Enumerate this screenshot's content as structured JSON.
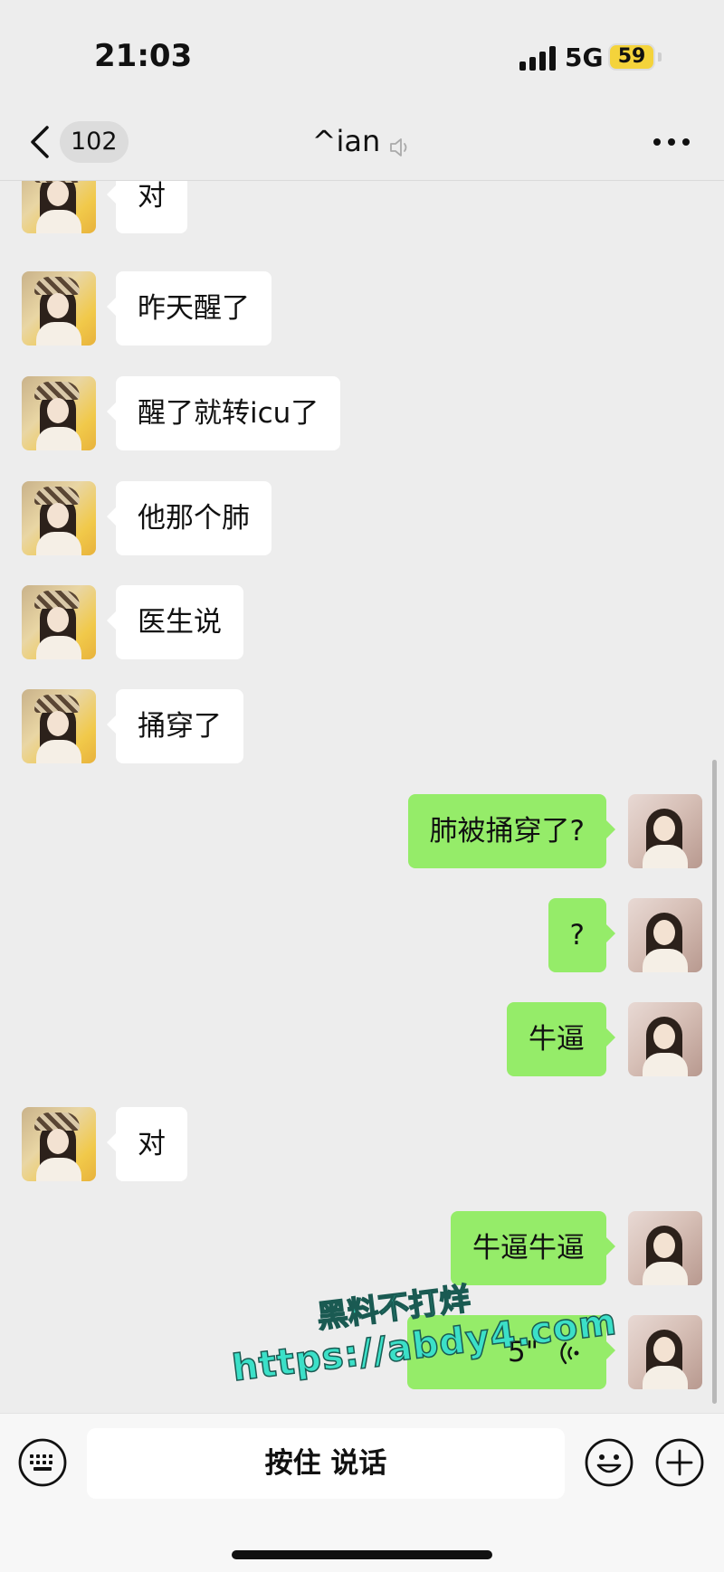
{
  "status_bar": {
    "time": "21:03",
    "network": "5G",
    "battery": "59"
  },
  "header": {
    "unread_count": "102",
    "title": "^ian"
  },
  "messages": [
    {
      "side": "in",
      "text": "对"
    },
    {
      "side": "in",
      "text": "昨天醒了"
    },
    {
      "side": "in",
      "text": "醒了就转icu了"
    },
    {
      "side": "in",
      "text": "他那个肺"
    },
    {
      "side": "in",
      "text": "医生说"
    },
    {
      "side": "in",
      "text": "捅穿了"
    },
    {
      "side": "out",
      "text": "肺被捅穿了?"
    },
    {
      "side": "out",
      "text": "?"
    },
    {
      "side": "out",
      "text": "牛逼"
    },
    {
      "side": "in",
      "text": "对"
    },
    {
      "side": "out",
      "text": "牛逼牛逼"
    },
    {
      "side": "out",
      "type": "voice",
      "duration": "5\""
    }
  ],
  "watermark": {
    "line1": "黑料不打烊",
    "line2": "https://abdy4.com"
  },
  "input_bar": {
    "hold_to_talk": "按住 说话"
  },
  "icons": {
    "back": "chevron-left-icon",
    "mute": "mute-icon",
    "more": "more-icon",
    "keyboard": "keyboard-icon",
    "emoji": "emoji-icon",
    "plus": "plus-icon",
    "voice": "voice-wave-icon"
  },
  "colors": {
    "bg": "#ededed",
    "bubble_in": "#ffffff",
    "bubble_out": "#95ec69",
    "battery": "#f4d33b"
  }
}
